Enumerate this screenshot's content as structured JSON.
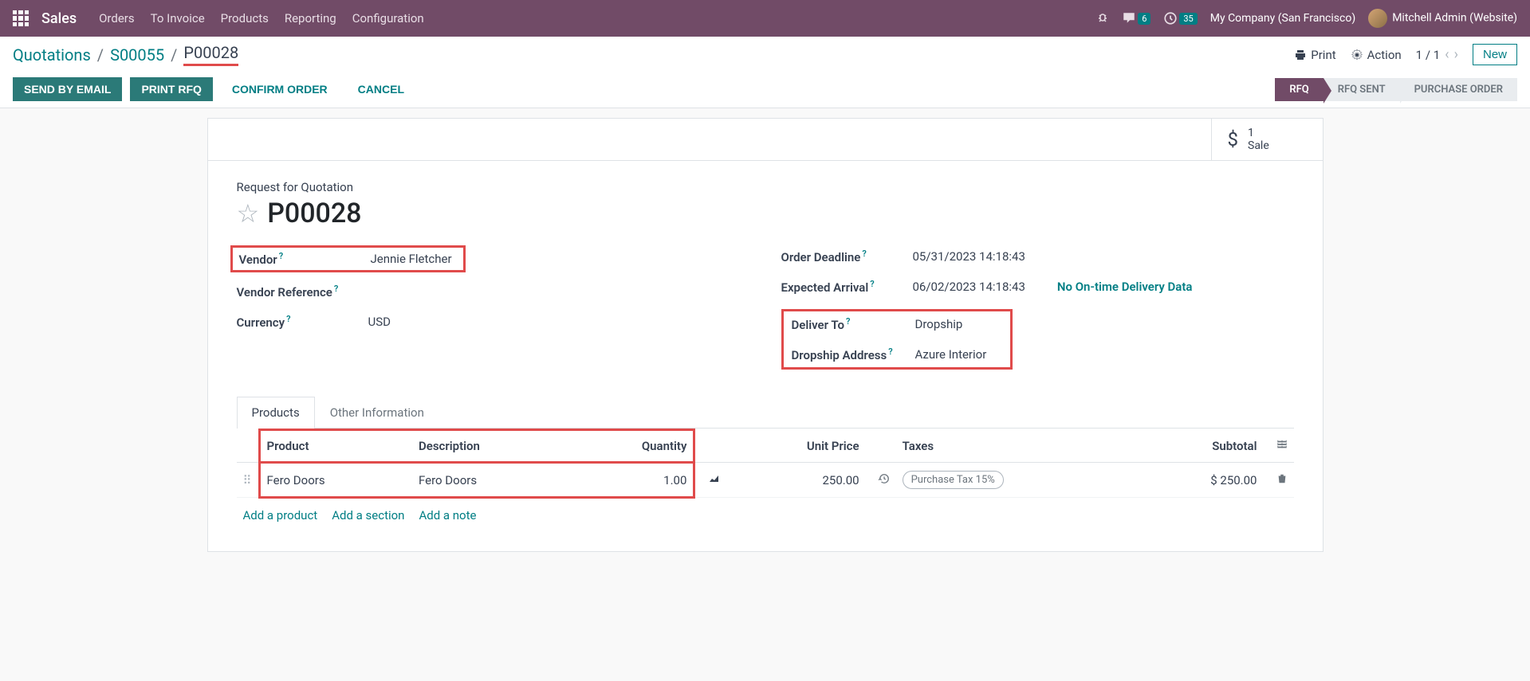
{
  "navbar": {
    "app_title": "Sales",
    "menu": [
      "Orders",
      "To Invoice",
      "Products",
      "Reporting",
      "Configuration"
    ],
    "messages_badge": "6",
    "activities_badge": "35",
    "company": "My Company (San Francisco)",
    "user": "Mitchell Admin (Website)"
  },
  "breadcrumb": {
    "items": [
      "Quotations",
      "S00055"
    ],
    "current": "P00028"
  },
  "cp": {
    "print": "Print",
    "action": "Action",
    "pager": "1 / 1",
    "new": "New"
  },
  "buttons": {
    "send_email": "SEND BY EMAIL",
    "print_rfq": "PRINT RFQ",
    "confirm": "CONFIRM ORDER",
    "cancel": "CANCEL"
  },
  "status": {
    "rfq": "RFQ",
    "rfq_sent": "RFQ SENT",
    "po": "PURCHASE ORDER"
  },
  "stat": {
    "count": "1",
    "label": "Sale"
  },
  "header": {
    "subtitle": "Request for Quotation",
    "title": "P00028"
  },
  "fields": {
    "vendor_label": "Vendor",
    "vendor_value": "Jennie Fletcher",
    "vendor_ref_label": "Vendor Reference",
    "currency_label": "Currency",
    "currency_value": "USD",
    "deadline_label": "Order Deadline",
    "deadline_value": "05/31/2023 14:18:43",
    "arrival_label": "Expected Arrival",
    "arrival_value": "06/02/2023 14:18:43",
    "deliver_label": "Deliver To",
    "deliver_value": "Dropship",
    "dropship_label": "Dropship Address",
    "dropship_value": "Azure Interior",
    "delivery_data": "No On-time Delivery Data"
  },
  "tabs": {
    "products": "Products",
    "other": "Other Information"
  },
  "table": {
    "headers": {
      "product": "Product",
      "description": "Description",
      "quantity": "Quantity",
      "unit_price": "Unit Price",
      "taxes": "Taxes",
      "subtotal": "Subtotal"
    },
    "row": {
      "product": "Fero Doors",
      "description": "Fero Doors",
      "quantity": "1.00",
      "unit_price": "250.00",
      "tax": "Purchase Tax 15%",
      "subtotal": "$ 250.00"
    },
    "add_product": "Add a product",
    "add_section": "Add a section",
    "add_note": "Add a note"
  }
}
